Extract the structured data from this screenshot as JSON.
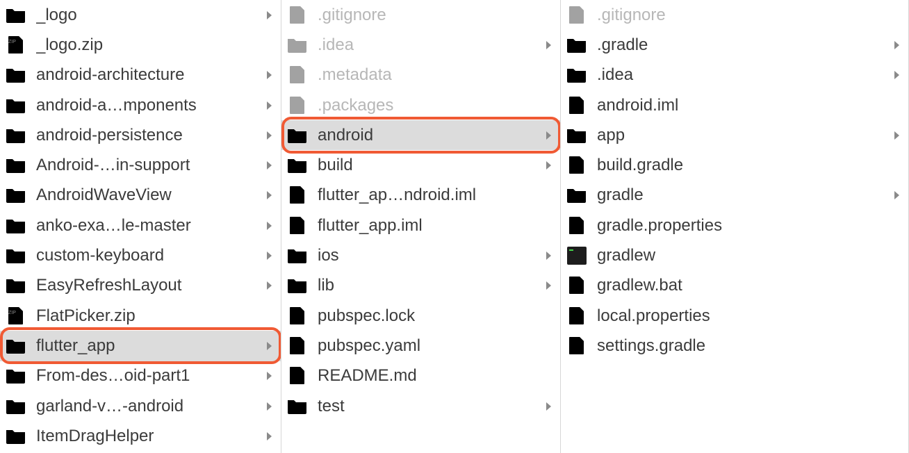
{
  "columns": [
    {
      "items": [
        {
          "name": "_logo",
          "icon": "folder",
          "hasChildren": true,
          "dimmed": false
        },
        {
          "name": "_logo.zip",
          "icon": "zip",
          "hasChildren": false,
          "dimmed": false
        },
        {
          "name": "android-architecture",
          "icon": "folder",
          "hasChildren": true,
          "dimmed": false
        },
        {
          "name": "android-a…mponents",
          "icon": "folder",
          "hasChildren": true,
          "dimmed": false
        },
        {
          "name": "android-persistence",
          "icon": "folder",
          "hasChildren": true,
          "dimmed": false
        },
        {
          "name": "Android-…in-support",
          "icon": "folder",
          "hasChildren": true,
          "dimmed": false
        },
        {
          "name": "AndroidWaveView",
          "icon": "folder",
          "hasChildren": true,
          "dimmed": false
        },
        {
          "name": "anko-exa…le-master",
          "icon": "folder",
          "hasChildren": true,
          "dimmed": false
        },
        {
          "name": "custom-keyboard",
          "icon": "folder",
          "hasChildren": true,
          "dimmed": false
        },
        {
          "name": "EasyRefreshLayout",
          "icon": "folder",
          "hasChildren": true,
          "dimmed": false
        },
        {
          "name": "FlatPicker.zip",
          "icon": "zip",
          "hasChildren": false,
          "dimmed": false
        },
        {
          "name": "flutter_app",
          "icon": "folder",
          "hasChildren": true,
          "dimmed": false,
          "selected": true,
          "highlight": true
        },
        {
          "name": "From-des…oid-part1",
          "icon": "folder",
          "hasChildren": true,
          "dimmed": false
        },
        {
          "name": "garland-v…-android",
          "icon": "folder",
          "hasChildren": true,
          "dimmed": false
        },
        {
          "name": "ItemDragHelper",
          "icon": "folder",
          "hasChildren": true,
          "dimmed": false
        }
      ]
    },
    {
      "items": [
        {
          "name": ".gitignore",
          "icon": "file",
          "hasChildren": false,
          "dimmed": true
        },
        {
          "name": ".idea",
          "icon": "folder",
          "hasChildren": true,
          "dimmed": true
        },
        {
          "name": ".metadata",
          "icon": "file",
          "hasChildren": false,
          "dimmed": true
        },
        {
          "name": ".packages",
          "icon": "file",
          "hasChildren": false,
          "dimmed": true
        },
        {
          "name": "android",
          "icon": "folder",
          "hasChildren": true,
          "dimmed": false,
          "selected": true,
          "highlight": true
        },
        {
          "name": "build",
          "icon": "folder",
          "hasChildren": true,
          "dimmed": false
        },
        {
          "name": "flutter_ap…ndroid.iml",
          "icon": "file",
          "hasChildren": false,
          "dimmed": false
        },
        {
          "name": "flutter_app.iml",
          "icon": "file",
          "hasChildren": false,
          "dimmed": false
        },
        {
          "name": "ios",
          "icon": "folder",
          "hasChildren": true,
          "dimmed": false
        },
        {
          "name": "lib",
          "icon": "folder",
          "hasChildren": true,
          "dimmed": false
        },
        {
          "name": "pubspec.lock",
          "icon": "file",
          "hasChildren": false,
          "dimmed": false
        },
        {
          "name": "pubspec.yaml",
          "icon": "file",
          "hasChildren": false,
          "dimmed": false
        },
        {
          "name": "README.md",
          "icon": "file",
          "hasChildren": false,
          "dimmed": false
        },
        {
          "name": "test",
          "icon": "folder",
          "hasChildren": true,
          "dimmed": false
        }
      ]
    },
    {
      "items": [
        {
          "name": ".gitignore",
          "icon": "file",
          "hasChildren": false,
          "dimmed": true
        },
        {
          "name": ".gradle",
          "icon": "folder",
          "hasChildren": true,
          "dimmed": false
        },
        {
          "name": ".idea",
          "icon": "folder",
          "hasChildren": true,
          "dimmed": false
        },
        {
          "name": "android.iml",
          "icon": "file",
          "hasChildren": false,
          "dimmed": false
        },
        {
          "name": "app",
          "icon": "folder",
          "hasChildren": true,
          "dimmed": false
        },
        {
          "name": "build.gradle",
          "icon": "file",
          "hasChildren": false,
          "dimmed": false
        },
        {
          "name": "gradle",
          "icon": "folder",
          "hasChildren": true,
          "dimmed": false
        },
        {
          "name": "gradle.properties",
          "icon": "file",
          "hasChildren": false,
          "dimmed": false
        },
        {
          "name": "gradlew",
          "icon": "exec",
          "hasChildren": false,
          "dimmed": false
        },
        {
          "name": "gradlew.bat",
          "icon": "file",
          "hasChildren": false,
          "dimmed": false
        },
        {
          "name": "local.properties",
          "icon": "file",
          "hasChildren": false,
          "dimmed": false
        },
        {
          "name": "settings.gradle",
          "icon": "file",
          "hasChildren": false,
          "dimmed": false
        }
      ]
    },
    {
      "items": []
    }
  ]
}
